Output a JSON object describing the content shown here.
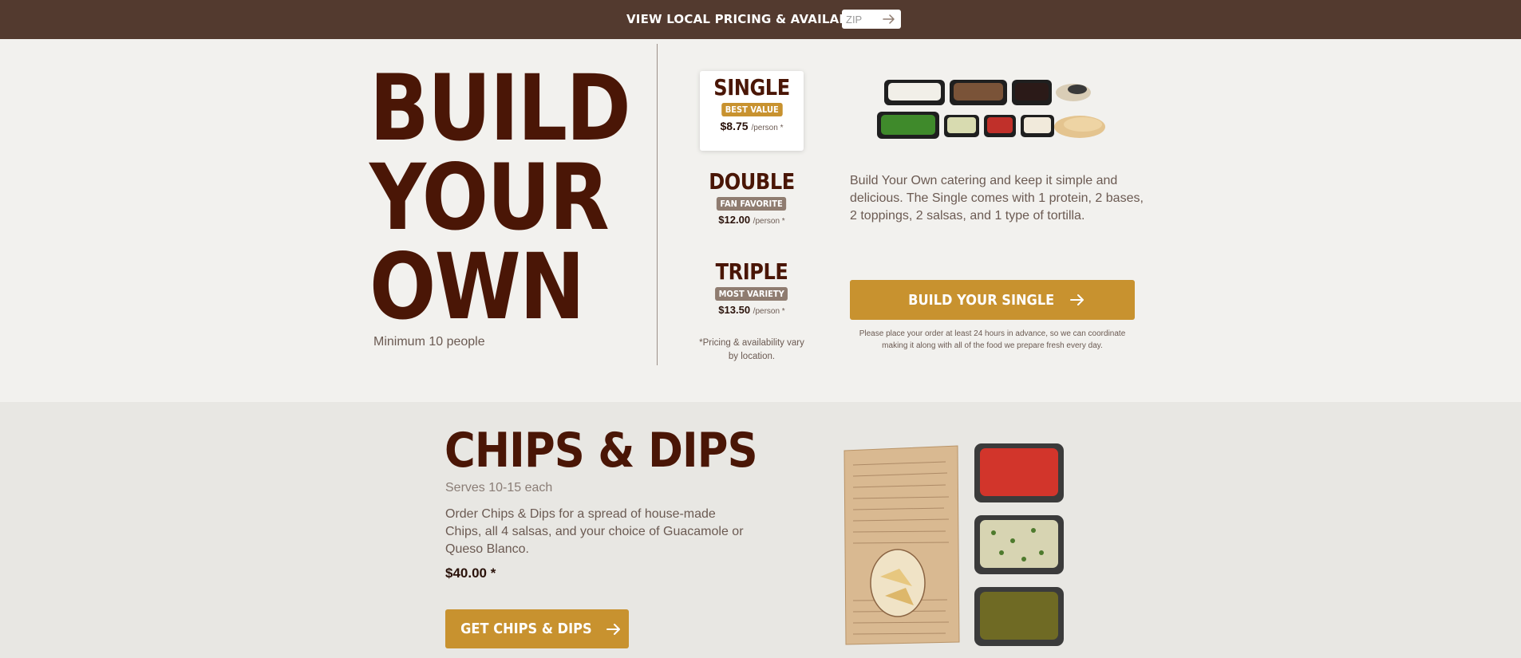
{
  "topbar": {
    "label": "VIEW LOCAL PRICING & AVAILABILITY",
    "zip_placeholder": "ZIP",
    "zip_value": ""
  },
  "hero": {
    "title_lines": [
      "BUILD",
      "YOUR",
      "OWN"
    ],
    "subtitle": "Minimum 10 people"
  },
  "tiers": [
    {
      "name": "SINGLE",
      "badge": "BEST VALUE",
      "price": "$8.75",
      "per": "/person *",
      "selected": true
    },
    {
      "name": "DOUBLE",
      "badge": "FAN FAVORITE",
      "price": "$12.00",
      "per": "/person *",
      "selected": false
    },
    {
      "name": "TRIPLE",
      "badge": "MOST VARIETY",
      "price": "$13.50",
      "per": "/person *",
      "selected": false
    }
  ],
  "pricing_note": "*Pricing & availability vary by location.",
  "build": {
    "description": "Build Your Own catering and keep it simple and delicious. The Single comes with 1 protein, 2 bases, 2 toppings, 2 salsas, and 1 type of tortilla.",
    "cta_label": "BUILD YOUR SINGLE",
    "advance_note": "Please place your order at least 24 hours in advance, so we can coordinate making it along with all of the food we prepare fresh every day."
  },
  "chips": {
    "title": "CHIPS & DIPS",
    "serves": "Serves 10-15 each",
    "description": "Order Chips & Dips for a spread of house-made Chips, all 4 salsas, and your choice of Guacamole or Queso Blanco.",
    "price": "$40.00 *",
    "cta_label": "GET CHIPS & DIPS"
  },
  "colors": {
    "topbar": "#533a2f",
    "brand_brown": "#4a1606",
    "accent_gold": "#c8922f",
    "badge_taupe": "#8f7c70"
  },
  "icons": {
    "zip_submit": "arrow-right-icon",
    "cta": "arrow-right-icon"
  }
}
